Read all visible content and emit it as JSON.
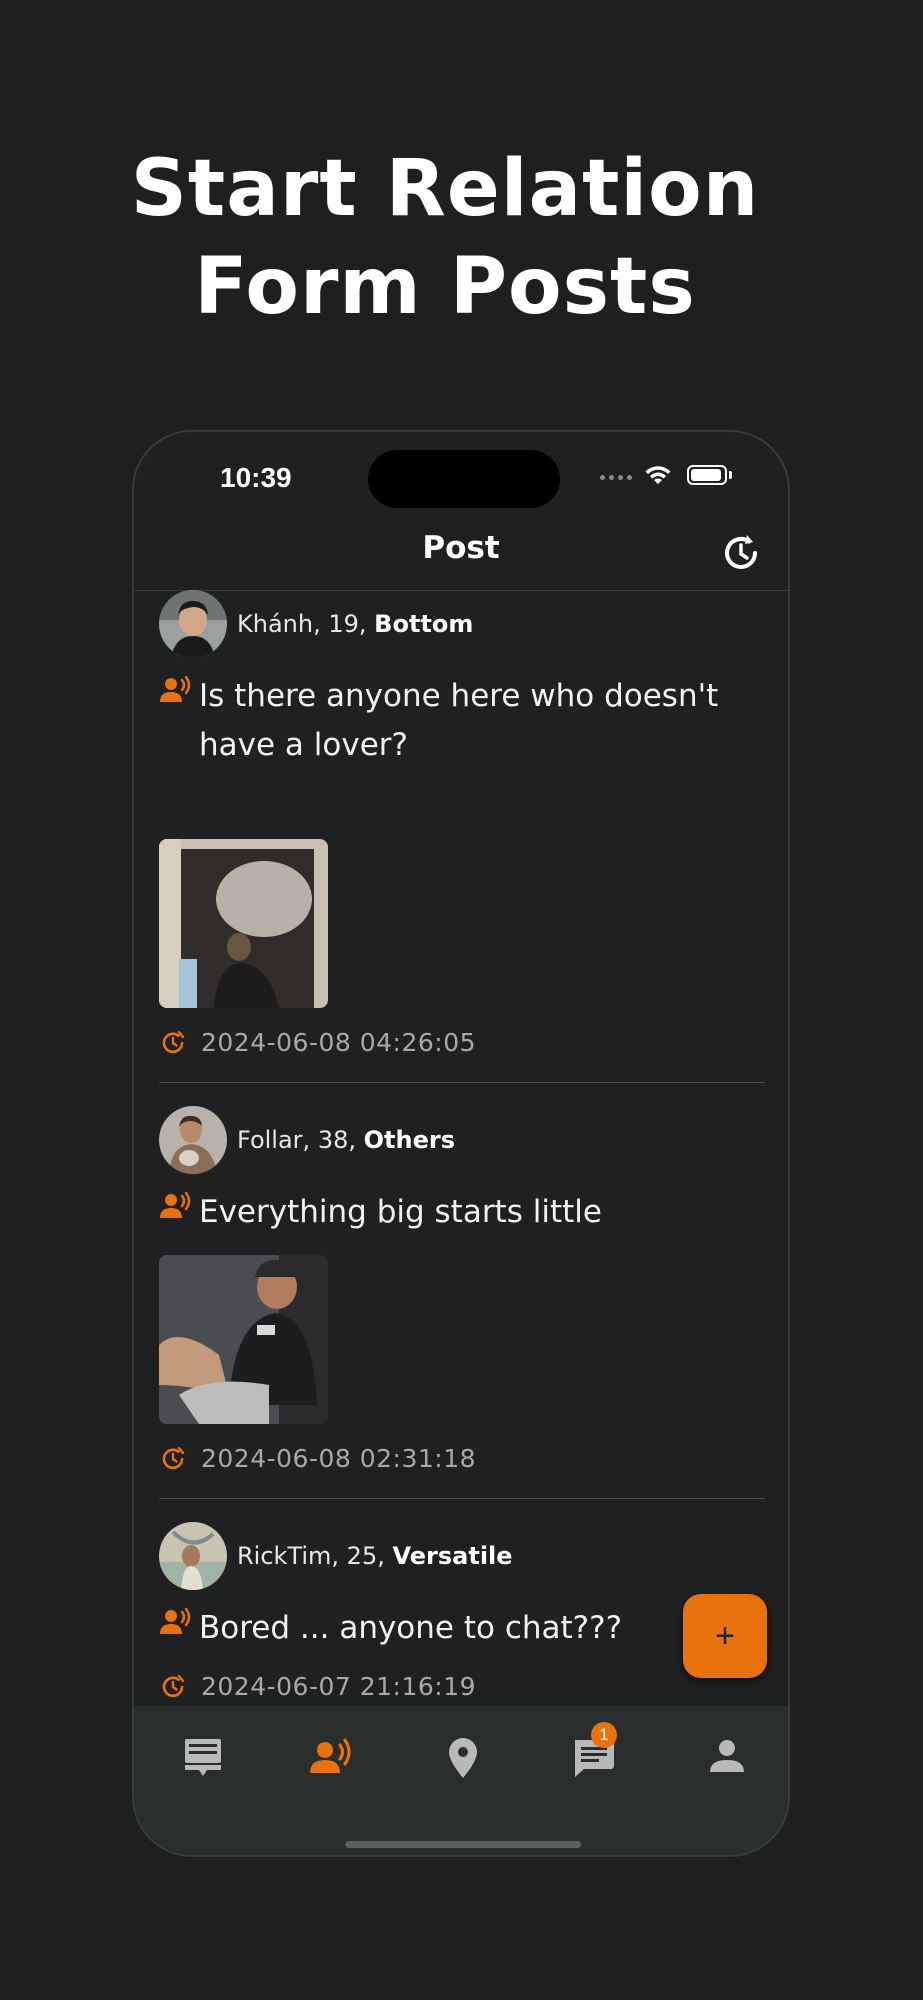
{
  "headline": {
    "line1": "Start Relation",
    "line2": "Form Posts"
  },
  "status_bar": {
    "time": "10:39"
  },
  "nav": {
    "title": "Post",
    "refresh_icon": "history-refresh-icon"
  },
  "posts": [
    {
      "name": "Khánh",
      "age": "19",
      "role": "Bottom",
      "text": "Is there anyone here who doesn't have a lover?",
      "has_photo": true,
      "timestamp": "2024-06-08 04:26:05"
    },
    {
      "name": "Follar",
      "age": "38",
      "role": "Others",
      "text": "Everything big starts little",
      "has_photo": true,
      "timestamp": "2024-06-08 02:31:18"
    },
    {
      "name": "RickTim",
      "age": "25",
      "role": "Versatile",
      "text": "Bored ... anyone to chat???",
      "has_photo": false,
      "timestamp": "2024-06-07 21:16:19"
    }
  ],
  "fab": {
    "label": "+"
  },
  "tabs": [
    {
      "icon": "feed-icon",
      "active": false
    },
    {
      "icon": "people-broadcast-icon",
      "active": true
    },
    {
      "icon": "location-pin-icon",
      "active": false
    },
    {
      "icon": "chat-icon",
      "active": false,
      "badge": "1"
    },
    {
      "icon": "profile-icon",
      "active": false
    }
  ],
  "colors": {
    "accent": "#e8720c",
    "background": "#1e1f21",
    "tab_inactive": "#b9b9bb"
  }
}
